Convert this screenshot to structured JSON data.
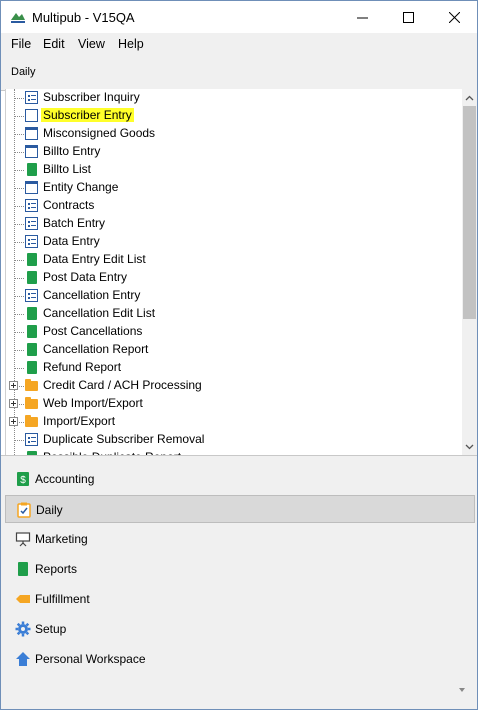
{
  "window": {
    "title": "Multipub - V15QA"
  },
  "menu": [
    "File",
    "Edit",
    "View",
    "Help"
  ],
  "section": {
    "title": "Daily"
  },
  "tree": [
    {
      "label": "Subscriber Inquiry",
      "icon": "form-lines-icon"
    },
    {
      "label": "Subscriber Entry",
      "icon": "form-icon",
      "highlighted": true
    },
    {
      "label": "Misconsigned Goods",
      "icon": "form-title-icon"
    },
    {
      "label": "Billto Entry",
      "icon": "form-title-icon"
    },
    {
      "label": "Billto List",
      "icon": "report-book-icon"
    },
    {
      "label": "Entity Change",
      "icon": "form-title-icon"
    },
    {
      "label": "Contracts",
      "icon": "form-lines-icon"
    },
    {
      "label": "Batch Entry",
      "icon": "form-lines-icon"
    },
    {
      "label": "Data Entry",
      "icon": "form-lines-icon"
    },
    {
      "label": "Data Entry Edit List",
      "icon": "report-book-icon"
    },
    {
      "label": "Post Data Entry",
      "icon": "report-book-icon"
    },
    {
      "label": "Cancellation Entry",
      "icon": "form-lines-icon"
    },
    {
      "label": "Cancellation Edit List",
      "icon": "report-book-icon"
    },
    {
      "label": "Post Cancellations",
      "icon": "report-book-icon"
    },
    {
      "label": "Cancellation Report",
      "icon": "report-book-icon"
    },
    {
      "label": "Refund Report",
      "icon": "report-book-icon"
    },
    {
      "label": "Credit Card / ACH Processing",
      "icon": "folder-icon",
      "expandable": true
    },
    {
      "label": "Web Import/Export",
      "icon": "folder-icon",
      "expandable": true
    },
    {
      "label": "Import/Export",
      "icon": "folder-icon",
      "expandable": true
    },
    {
      "label": "Duplicate Subscriber Removal",
      "icon": "form-lines-icon"
    },
    {
      "label": "Possible Duplicate Report",
      "icon": "report-book-icon"
    }
  ],
  "nav": [
    {
      "label": "Accounting",
      "icon": "accounting-icon"
    },
    {
      "label": "Daily",
      "icon": "clipboard-icon",
      "selected": true
    },
    {
      "label": "Marketing",
      "icon": "presentation-icon"
    },
    {
      "label": "Reports",
      "icon": "report-book-icon"
    },
    {
      "label": "Fulfillment",
      "icon": "fulfillment-icon"
    },
    {
      "label": "Setup",
      "icon": "gear-icon"
    },
    {
      "label": "Personal Workspace",
      "icon": "home-icon"
    }
  ],
  "colors": {
    "highlight": "#ffff2a",
    "green": "#1f9e4a",
    "folder": "#f5a623",
    "blue": "#2a5aa0"
  }
}
